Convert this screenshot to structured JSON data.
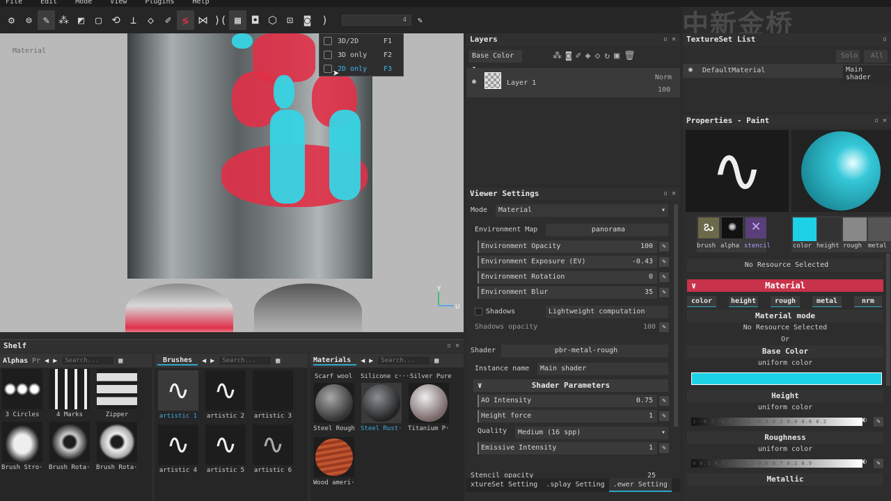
{
  "menu": [
    "File",
    "Edit",
    "Mode",
    "View",
    "Plugins",
    "Help"
  ],
  "toolbar": {
    "icons": [
      "app-logo-icon",
      "lock-icon",
      "paint-brush-icon",
      "node-icon",
      "projection-icon",
      "select-rect-icon",
      "lasso-icon",
      "stamp-icon",
      "fill-icon",
      "eyedropper-icon",
      "smudge-icon",
      "symmetry-icon",
      "mirror-icon",
      "magnet-icon",
      "grid-mode-icon",
      "camera-icon",
      "cube-icon",
      "screenshot-icon",
      "sound-icon"
    ],
    "slider_value": "4"
  },
  "watermark": "中新金桥",
  "view_mode_menu": [
    {
      "label": "3D/2D",
      "key": "F1"
    },
    {
      "label": "3D only",
      "key": "F2"
    },
    {
      "label": "2D only",
      "key": "F3"
    }
  ],
  "viewport": {
    "label": "Material",
    "axis_y": "Y",
    "axis_u": "U"
  },
  "shelf": {
    "title": "Shelf",
    "alphas": {
      "tab": "Alphas",
      "tab2": "Pr",
      "search": "Search...",
      "items": [
        "3 Circles",
        "4 Marks",
        "Zipper",
        "Brush Stro···",
        "Brush Rota···",
        "Brush Rota···"
      ]
    },
    "brushes": {
      "tab": "Brushes",
      "search": "Search...",
      "items": [
        "artistic 1",
        "artistic 2",
        "artistic 3",
        "artistic 4",
        "artistic 5",
        "artistic 6"
      ]
    },
    "materials": {
      "tab": "Materials",
      "search": "Search...",
      "top_labels": [
        "Scarf wool",
        "Silicone c···",
        "Silver Pure"
      ],
      "items": [
        "Steel Rough",
        "Steel Rust···",
        "Titanium P···",
        "Wood ameri···"
      ]
    }
  },
  "layers": {
    "title": "Layers",
    "channel": "Base Color",
    "layer_name": "Layer 1",
    "blend": "Norm",
    "opacity": "100"
  },
  "viewer": {
    "title": "Viewer Settings",
    "mode_label": "Mode",
    "mode_value": "Material",
    "env_map_label": "Environment Map",
    "env_map_value": "panorama",
    "env_opacity_label": "Environment Opacity",
    "env_opacity": "100",
    "env_exposure_label": "Environment Exposure (EV)",
    "env_exposure": "-0.43",
    "env_rotation_label": "Environment Rotation",
    "env_rotation": "0",
    "env_blur_label": "Environment Blur",
    "env_blur": "35",
    "shadows_label": "Shadows",
    "shadows_btn": "Lightweight computation",
    "shadows_opacity_label": "Shadows opacity",
    "shadows_opacity": "100",
    "shader_label": "Shader",
    "shader_value": "pbr-metal-rough",
    "instance_label": "Instance name",
    "instance_value": "Main shader",
    "shader_params": "Shader Parameters",
    "ao_label": "AO Intensity",
    "ao": "0.75",
    "height_force_label": "Height force",
    "height_force": "1",
    "quality_label": "Quality",
    "quality_value": "Medium (16 spp)",
    "emissive_label": "Emissive Intensity",
    "emissive": "1",
    "stencil_label": "Stencil opacity",
    "stencil": "25",
    "bottom_tabs": [
      "xtureSet Setting",
      ".splay Setting",
      ".ewer Setting"
    ]
  },
  "texset": {
    "title": "TextureSet List",
    "solo": "Solo",
    "all": "All",
    "material": "DefaultMaterial",
    "shader": "Main shader"
  },
  "props": {
    "title": "Properties - Paint",
    "tools": [
      "brush",
      "alpha",
      "stencil"
    ],
    "chips": [
      "color",
      "height",
      "rough",
      "metal"
    ],
    "no_resource": "No Resource Selected",
    "material_header": "Material",
    "mat_tags": [
      "color",
      "height",
      "rough",
      "metal",
      "nrm"
    ],
    "material_mode": "Material mode",
    "no_resource2": "No Resource Selected",
    "or": "Or",
    "base_color": "Base Color",
    "uniform1": "uniform color",
    "height": "Height",
    "uniform2": "uniform color",
    "height_ticks": "1 -0.2 -0.6 -0.4 -0.2   0.2 0.4 0.6 0.2",
    "roughness": "Roughness",
    "uniform3": "uniform color",
    "rough_ticks": "0 0.1 0.2 0.3   0.5 0.6 0.7 0.2 0.9",
    "metallic": "Metallic",
    "colors": {
      "cyan": "#1ed2e6",
      "accent": "#c8324a"
    }
  }
}
